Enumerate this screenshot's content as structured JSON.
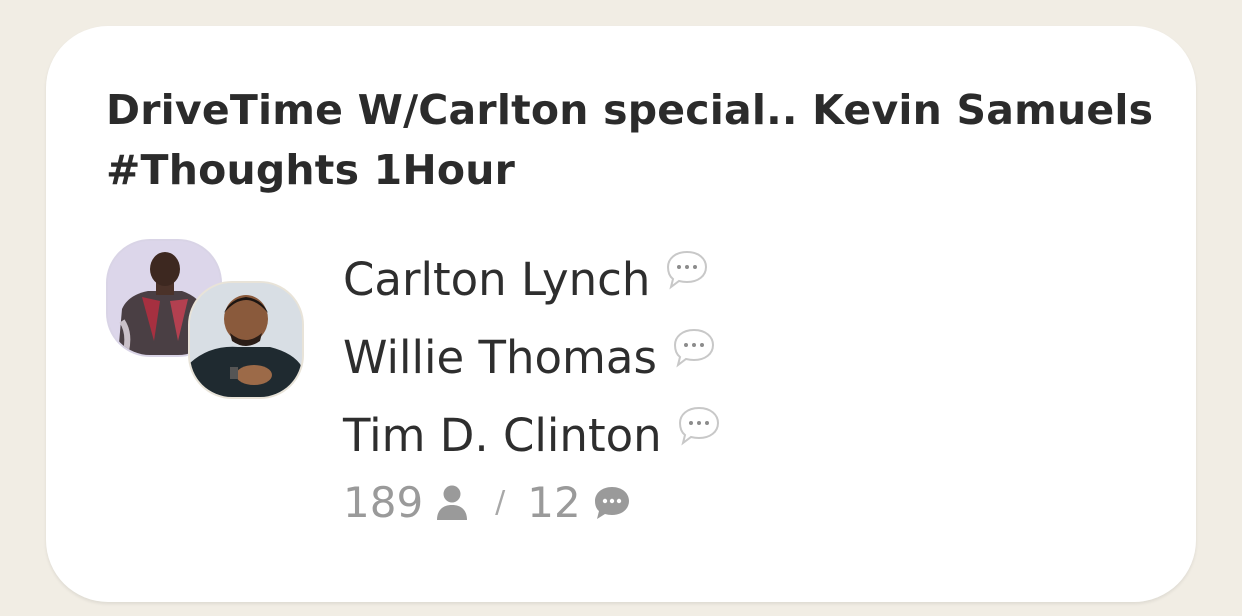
{
  "room": {
    "title": "DriveTime W/Carlton special.. Kevin Samuels #Thoughts 1Hour",
    "speakers": [
      {
        "name": "Carlton Lynch",
        "icon": "speech-bubble-icon"
      },
      {
        "name": "Willie Thomas",
        "icon": "speech-bubble-icon"
      },
      {
        "name": "Tim D. Clinton",
        "icon": "speech-bubble-icon"
      }
    ],
    "listener_count": "189",
    "listener_icon": "person-icon",
    "separator": "/",
    "speaker_count": "12",
    "speaker_icon": "chat-bubble-icon"
  },
  "colors": {
    "background": "#f1ede4",
    "card": "#ffffff",
    "text": "#2b2b2b",
    "muted": "#9a9a9a"
  }
}
